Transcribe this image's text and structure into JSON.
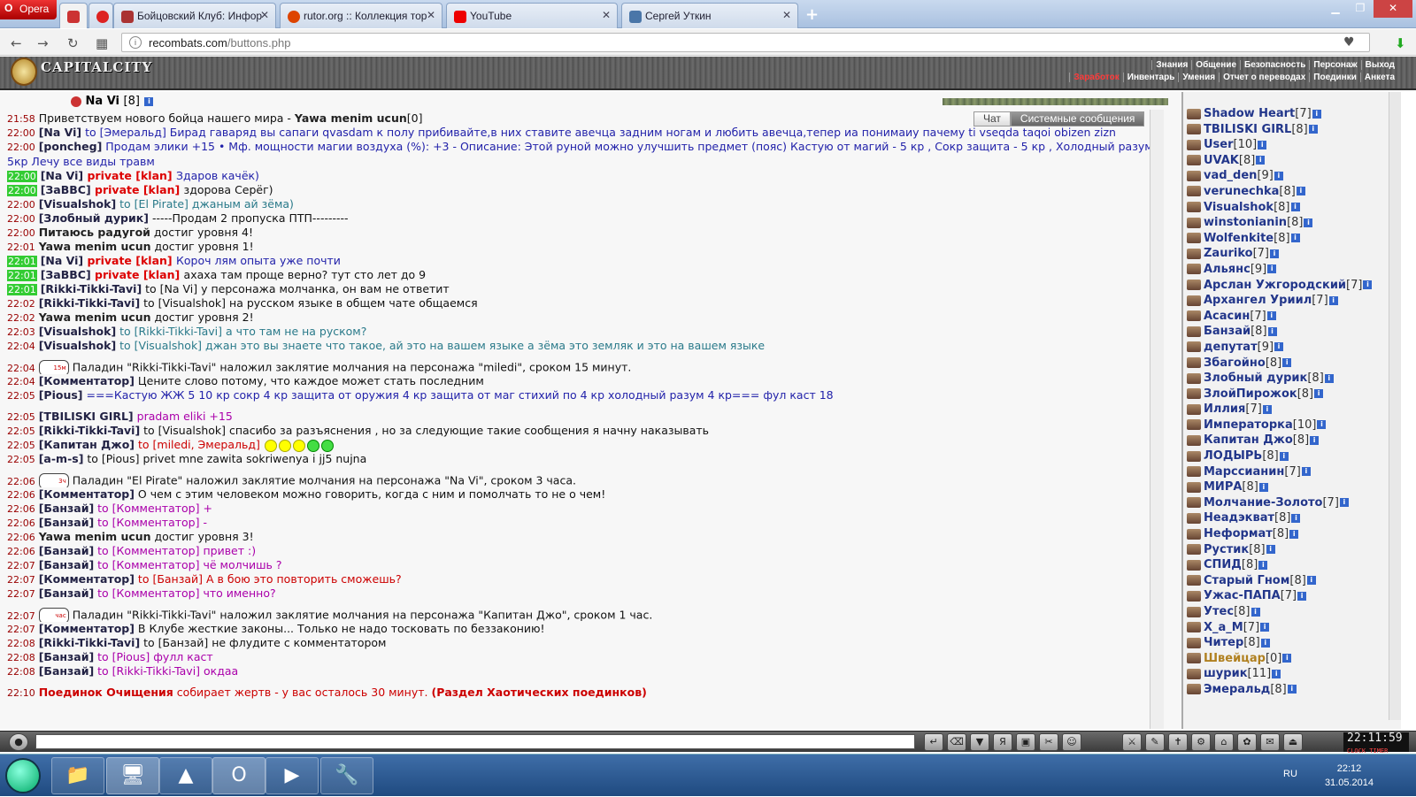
{
  "browser": {
    "menu_label": "Opera",
    "tabs": [
      {
        "label": "",
        "active": true
      },
      {
        "label": ""
      },
      {
        "label": "Бойцовский Клуб: Инфор"
      },
      {
        "label": "rutor.org :: Коллекция тор"
      },
      {
        "label": "YouTube"
      },
      {
        "label": "Сергей Уткин"
      }
    ],
    "url_host": "recombats.com",
    "url_path": "/buttons.php"
  },
  "game": {
    "logo": "CAPITALCITY",
    "menu_top": [
      "Знания",
      "Общение",
      "Безопасность",
      "Персонаж",
      "Выход"
    ],
    "menu_bottom": [
      "Заработок",
      "Инвентарь",
      "Умения",
      "Отчет о переводах",
      "Поединки",
      "Анкета"
    ],
    "player_name": "Na Vi",
    "player_level": "[8]",
    "chat_tabs": [
      "Чат",
      "Системные сообщения"
    ]
  },
  "chat": [
    {
      "time": "21:58",
      "parts": [
        {
          "c": "dark",
          "t": "Приветствуем нового бойца нашего мира - "
        },
        {
          "c": "b",
          "t": "Yawa menim ucun"
        },
        {
          "c": "dark",
          "t": "[0]"
        }
      ]
    },
    {
      "time": "22:00",
      "parts": [
        {
          "c": "n",
          "t": "[Na Vi]"
        },
        {
          "c": "blue",
          "t": " to [Эмеральд] Бирад гаваряд вы сапаги qvasdam к полу прибивайте,в них ставите авечца задним ногам и любить авечца,тепер иа понимаиу пачему ti vseqda taqoi obizen zizn"
        }
      ]
    },
    {
      "time": "22:00",
      "wrap": true,
      "parts": [
        {
          "c": "n",
          "t": "[poncheg]"
        },
        {
          "c": "blue",
          "t": " Продам элики +15 "
        },
        {
          "c": "blue",
          "t": "• Мф. мощности магии воздуха (%): +3 - Описание: Этой руной можно улучшить предмет (пояс) "
        },
        {
          "c": "blue",
          "t": "Кастую от магий - 5 кр , Сокр защита - 5 кр , Холодный разум - 5кр "
        },
        {
          "c": "blue",
          "t": "Лечу все виды травм"
        }
      ]
    },
    {
      "time": "22:00",
      "g": true,
      "parts": [
        {
          "c": "n",
          "t": "[Na Vi]"
        },
        {
          "c": "priv",
          "t": " private [klan] "
        },
        {
          "c": "blue",
          "t": "Здаров качёк)"
        }
      ]
    },
    {
      "time": "22:00",
      "g": true,
      "parts": [
        {
          "c": "n",
          "t": "[ЗаВВС]"
        },
        {
          "c": "priv",
          "t": " private [klan] "
        },
        {
          "c": "dark",
          "t": "здорова Серёг)"
        }
      ]
    },
    {
      "time": "22:00",
      "parts": [
        {
          "c": "n",
          "t": "[Visualshok]"
        },
        {
          "c": "teal",
          "t": " to [El Pirate] джаным ай зёма)"
        }
      ]
    },
    {
      "time": "22:00",
      "parts": [
        {
          "c": "n",
          "t": "[Злобный дурик]"
        },
        {
          "c": "dark",
          "t": " -----Продам 2 пропуска ПТП---------"
        }
      ]
    },
    {
      "time": "22:00",
      "parts": [
        {
          "c": "b",
          "t": "Питаюсь радугой"
        },
        {
          "c": "dark",
          "t": " достиг уровня 4!"
        }
      ]
    },
    {
      "time": "22:01",
      "parts": [
        {
          "c": "b",
          "t": "Yawa menim ucun"
        },
        {
          "c": "dark",
          "t": " достиг уровня 1!"
        }
      ]
    },
    {
      "time": "22:01",
      "g": true,
      "parts": [
        {
          "c": "n",
          "t": "[Na Vi]"
        },
        {
          "c": "priv",
          "t": " private [klan] "
        },
        {
          "c": "blue",
          "t": "Короч лям опыта уже почти"
        }
      ]
    },
    {
      "time": "22:01",
      "g": true,
      "parts": [
        {
          "c": "n",
          "t": "[ЗаВВС]"
        },
        {
          "c": "priv",
          "t": " private [klan] "
        },
        {
          "c": "dark",
          "t": "ахаха там проще верно? тут сто лет до 9"
        }
      ]
    },
    {
      "time": "22:01",
      "g": true,
      "parts": [
        {
          "c": "n",
          "t": "[Rikki-Tikki-Tavi]"
        },
        {
          "c": "dark",
          "t": " to [Na Vi] у персонажа молчанка, он вам не ответит"
        }
      ]
    },
    {
      "time": "22:02",
      "parts": [
        {
          "c": "n",
          "t": "[Rikki-Tikki-Tavi]"
        },
        {
          "c": "dark",
          "t": " to [Visualshok] на русском языке в общем чате общаемся"
        }
      ]
    },
    {
      "time": "22:02",
      "parts": [
        {
          "c": "b",
          "t": "Yawa menim ucun"
        },
        {
          "c": "dark",
          "t": " достиг уровня 2!"
        }
      ]
    },
    {
      "time": "22:03",
      "parts": [
        {
          "c": "n",
          "t": "[Visualshok]"
        },
        {
          "c": "teal",
          "t": " to [Rikki-Tikki-Tavi] а что там не на руском?"
        }
      ]
    },
    {
      "time": "22:04",
      "parts": [
        {
          "c": "n",
          "t": "[Visualshok]"
        },
        {
          "c": "teal",
          "t": " to [Visualshok] джан это вы знаете что такое, ай это на вашем языке а зёма это земляк и это на вашем языке"
        }
      ]
    },
    {
      "time": "22:04",
      "tall": true,
      "stamp": "15м",
      "parts": [
        {
          "c": "dark",
          "t": "Паладин \"Rikki-Tikki-Tavi\" наложил заклятие молчания на персонажа \"miledi\", сроком 15 минут."
        }
      ]
    },
    {
      "time": "22:04",
      "parts": [
        {
          "c": "n",
          "t": "[Комментатор]"
        },
        {
          "c": "dark",
          "t": " Цените слово потому, что каждое может стать последним"
        }
      ]
    },
    {
      "time": "22:05",
      "parts": [
        {
          "c": "n",
          "t": "[Pious]"
        },
        {
          "c": "blue",
          "t": " ===Кастую ЖЖ 5 10 кр сокр 4 кр защита от оружия 4 кр защита от маг стихий по 4 кр холодный разум 4 кр=== фул каст 18"
        }
      ]
    },
    {
      "time": "22:05",
      "tall": true,
      "parts": [
        {
          "c": "n",
          "t": "[TBILISKI GIRL]"
        },
        {
          "c": "purple",
          "t": " pradam eliki +15"
        }
      ]
    },
    {
      "time": "22:05",
      "parts": [
        {
          "c": "n",
          "t": "[Rikki-Tikki-Tavi]"
        },
        {
          "c": "dark",
          "t": " to [Visualshok] спасибо за разъяснения , но за следующие такие сообщения я начну наказывать"
        }
      ]
    },
    {
      "time": "22:05",
      "smiles": 5,
      "parts": [
        {
          "c": "n",
          "t": "[Капитан Джо]"
        },
        {
          "c": "red",
          "t": " to [miledi, Эмеральд] "
        }
      ]
    },
    {
      "time": "22:05",
      "parts": [
        {
          "c": "n",
          "t": "[a-m-s]"
        },
        {
          "c": "dark",
          "t": " to [Pious] privet mne zawita sokriwenya i jj5 nujna"
        }
      ]
    },
    {
      "time": "22:06",
      "tall": true,
      "stamp": "3ч",
      "parts": [
        {
          "c": "dark",
          "t": "Паладин \"El Pirate\" наложил заклятие молчания на персонажа \"Na Vi\", сроком 3 часа."
        }
      ]
    },
    {
      "time": "22:06",
      "parts": [
        {
          "c": "n",
          "t": "[Комментатор]"
        },
        {
          "c": "dark",
          "t": " О чем с этим человеком можно говорить, когда с ним и помолчать то не о чем!"
        }
      ]
    },
    {
      "time": "22:06",
      "parts": [
        {
          "c": "n",
          "t": "[Банзай]"
        },
        {
          "c": "purple",
          "t": " to [Комментатор] +"
        }
      ]
    },
    {
      "time": "22:06",
      "parts": [
        {
          "c": "n",
          "t": "[Банзай]"
        },
        {
          "c": "purple",
          "t": " to [Комментатор] -"
        }
      ]
    },
    {
      "time": "22:06",
      "parts": [
        {
          "c": "b",
          "t": "Yawa menim ucun"
        },
        {
          "c": "dark",
          "t": " достиг уровня 3!"
        }
      ]
    },
    {
      "time": "22:06",
      "parts": [
        {
          "c": "n",
          "t": "[Банзай]"
        },
        {
          "c": "purple",
          "t": " to [Комментатор] привет :)"
        }
      ]
    },
    {
      "time": "22:07",
      "parts": [
        {
          "c": "n",
          "t": "[Банзай]"
        },
        {
          "c": "purple",
          "t": " to [Комментатор] чё молчишь ?"
        }
      ]
    },
    {
      "time": "22:07",
      "parts": [
        {
          "c": "n",
          "t": "[Комментатор]"
        },
        {
          "c": "red",
          "t": " to [Банзай] А в бою это повторить сможешь?"
        }
      ]
    },
    {
      "time": "22:07",
      "parts": [
        {
          "c": "n",
          "t": "[Банзай]"
        },
        {
          "c": "purple",
          "t": " to [Комментатор] что именно?"
        }
      ]
    },
    {
      "time": "22:07",
      "tall": true,
      "stamp": "час",
      "parts": [
        {
          "c": "dark",
          "t": "Паладин \"Rikki-Tikki-Tavi\" наложил заклятие молчания на персонажа \"Капитан Джо\", сроком 1 час."
        }
      ]
    },
    {
      "time": "22:07",
      "parts": [
        {
          "c": "n",
          "t": "[Комментатор]"
        },
        {
          "c": "dark",
          "t": " В Клубе жесткие законы... Только не надо тосковать по беззаконию!"
        }
      ]
    },
    {
      "time": "22:08",
      "parts": [
        {
          "c": "n",
          "t": "[Rikki-Tikki-Tavi]"
        },
        {
          "c": "dark",
          "t": " to [Банзай] не флудите с комментатором"
        }
      ]
    },
    {
      "time": "22:08",
      "parts": [
        {
          "c": "n",
          "t": "[Банзай]"
        },
        {
          "c": "purple",
          "t": " to [Pious] фулл каст"
        }
      ]
    },
    {
      "time": "22:08",
      "parts": [
        {
          "c": "n",
          "t": "[Банзай]"
        },
        {
          "c": "purple",
          "t": " to [Rikki-Tikki-Tavi] окдаа"
        }
      ]
    },
    {
      "time": "22:10",
      "tall": true,
      "parts": [
        {
          "c": "redb",
          "t": "Поединок Очищения"
        },
        {
          "c": "red",
          "t": " собирает жертв - у вас осталось 30 минут. "
        },
        {
          "c": "redb",
          "t": "(Раздел Хаотических поединков)"
        }
      ]
    }
  ],
  "users": [
    {
      "name": "Shadow Heart",
      "lvl": "[7]"
    },
    {
      "name": "TBILISKI GIRL",
      "lvl": "[8]"
    },
    {
      "name": "User",
      "lvl": "[10]"
    },
    {
      "name": "UVAK",
      "lvl": "[8]"
    },
    {
      "name": "vad_den",
      "lvl": "[9]"
    },
    {
      "name": "verunechka",
      "lvl": "[8]"
    },
    {
      "name": "Visualshok",
      "lvl": "[8]"
    },
    {
      "name": "winstonianin",
      "lvl": "[8]"
    },
    {
      "name": "Wolfenkite",
      "lvl": "[8]"
    },
    {
      "name": "Zauriko",
      "lvl": "[7]"
    },
    {
      "name": "Альянс",
      "lvl": "[9]"
    },
    {
      "name": "Арслан Ужгородский",
      "lvl": "[7]"
    },
    {
      "name": "Архангел Уриил",
      "lvl": "[7]"
    },
    {
      "name": "Асасин",
      "lvl": "[7]"
    },
    {
      "name": "Банзай",
      "lvl": "[8]"
    },
    {
      "name": "депутат",
      "lvl": "[9]"
    },
    {
      "name": "Збагойно",
      "lvl": "[8]"
    },
    {
      "name": "Злобный дурик",
      "lvl": "[8]"
    },
    {
      "name": "ЗлойПирожок",
      "lvl": "[8]"
    },
    {
      "name": "Иллия",
      "lvl": "[7]"
    },
    {
      "name": "Императорка",
      "lvl": "[10]"
    },
    {
      "name": "Капитан Джо",
      "lvl": "[8]"
    },
    {
      "name": "ЛОДЫРЬ",
      "lvl": "[8]"
    },
    {
      "name": "Марссианин",
      "lvl": "[7]"
    },
    {
      "name": "МИРА",
      "lvl": "[8]"
    },
    {
      "name": "Молчание-Золото",
      "lvl": "[7]"
    },
    {
      "name": "Неадэкват",
      "lvl": "[8]"
    },
    {
      "name": "Неформат",
      "lvl": "[8]"
    },
    {
      "name": "Рустик",
      "lvl": "[8]"
    },
    {
      "name": "СПИД",
      "lvl": "[8]"
    },
    {
      "name": "Старый Гном",
      "lvl": "[8]"
    },
    {
      "name": "Ужас-ПАПА",
      "lvl": "[7]"
    },
    {
      "name": "Утес",
      "lvl": "[8]"
    },
    {
      "name": "X_a_M",
      "lvl": "[7]"
    },
    {
      "name": "Читер",
      "lvl": "[8]"
    },
    {
      "name": "Швейцар",
      "lvl": "[0]",
      "guard": true
    },
    {
      "name": "шурик",
      "lvl": "[11]"
    },
    {
      "name": "Эмеральд",
      "lvl": "[8]"
    }
  ],
  "clock": {
    "time": "22:11",
    "sec": "59",
    "label": "CLOCK TIMER"
  },
  "taskbar": {
    "lang": "RU",
    "time": "22:12",
    "date": "31.05.2014"
  }
}
